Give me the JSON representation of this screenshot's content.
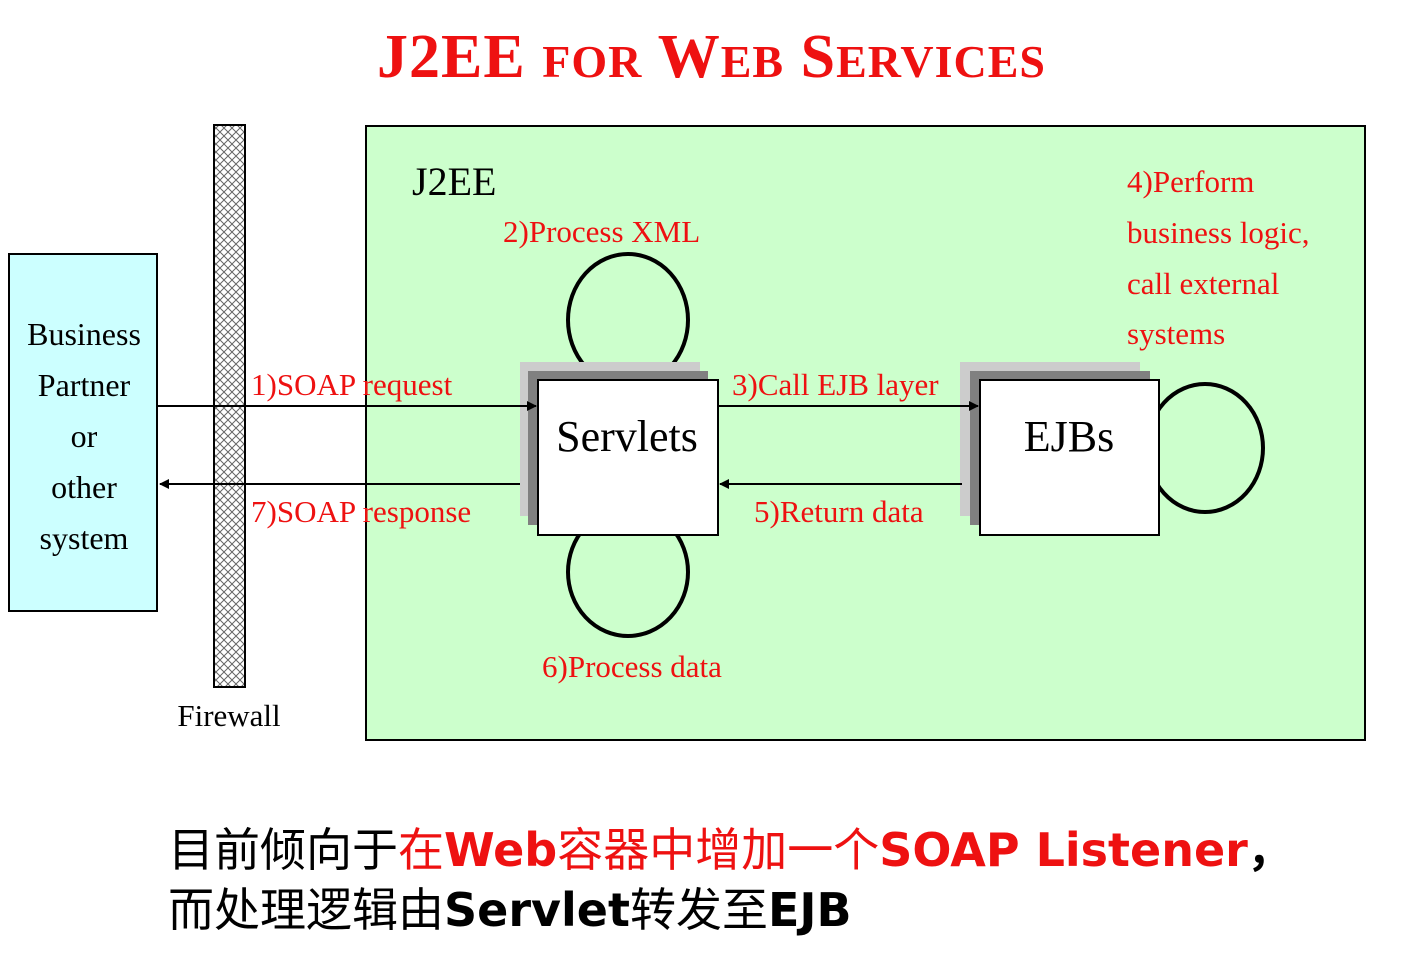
{
  "title": {
    "big1": "J2EE",
    "small1": "FOR",
    "big2": "W",
    "small2": "EB",
    "big3": "S",
    "small3": "ERVICES"
  },
  "diagram": {
    "container_label": "J2EE",
    "partner_lines": [
      "Business",
      "Partner",
      "or",
      "other",
      "system"
    ],
    "firewall_label": "Firewall",
    "servlets_label": "Servlets",
    "ejbs_label": "EJBs",
    "steps": {
      "s1": "1)SOAP request",
      "s2": "2)Process XML",
      "s3": "3)Call EJB layer",
      "s4_lines": [
        "4)Perform",
        "business logic,",
        "call external",
        "systems"
      ],
      "s5": "5)Return data",
      "s6": "6)Process data",
      "s7": "7)SOAP response"
    },
    "colors": {
      "container_fill": "#ccffcc",
      "partner_fill": "#ccffff",
      "step_text": "#ee1111"
    }
  },
  "caption": {
    "line1": {
      "a": "目前倾向于",
      "b": "在",
      "c": "Web",
      "d": "容器中增加一个",
      "e": "SOAP Listener",
      "f": "，"
    },
    "line2": {
      "a": "而处理逻辑由",
      "b": "Servlet",
      "c": "转发至",
      "d": "EJB"
    }
  }
}
